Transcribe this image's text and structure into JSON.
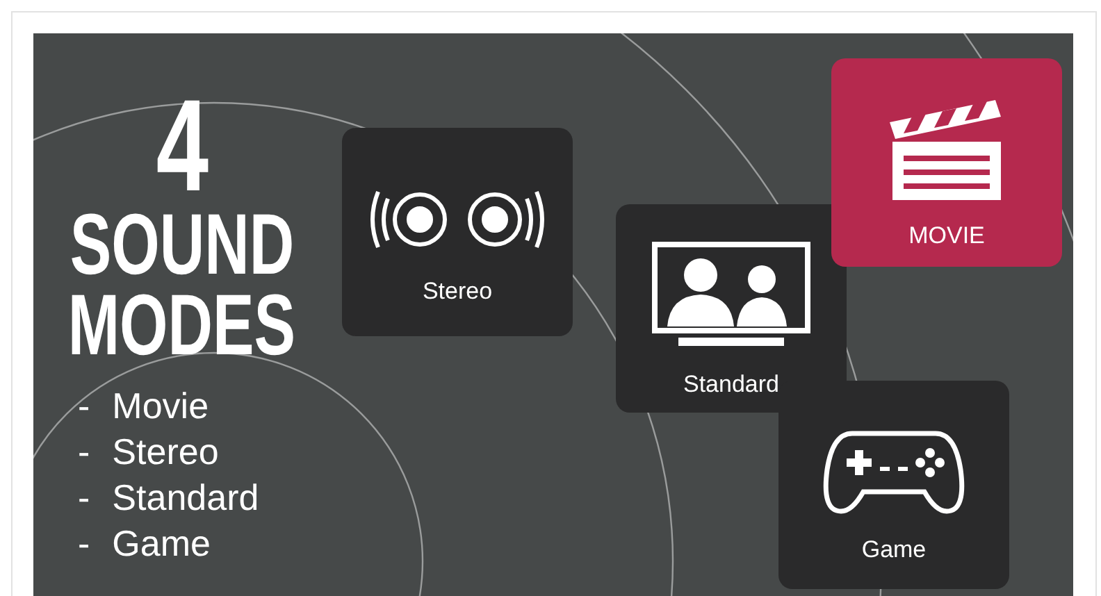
{
  "headline": {
    "lines": [
      "4",
      "SOUND",
      "MODES"
    ]
  },
  "modes_list": [
    {
      "bullet": "-",
      "label": "Movie"
    },
    {
      "bullet": "-",
      "label": "Stereo"
    },
    {
      "bullet": "-",
      "label": "Standard"
    },
    {
      "bullet": "-",
      "label": "Game"
    }
  ],
  "tiles": [
    {
      "kind": "stereo",
      "label": "Stereo",
      "selected": false
    },
    {
      "kind": "standard",
      "label": "Standard",
      "selected": false
    },
    {
      "kind": "movie",
      "label": "MOVIE",
      "selected": true
    },
    {
      "kind": "game",
      "label": "Game",
      "selected": false
    }
  ]
}
